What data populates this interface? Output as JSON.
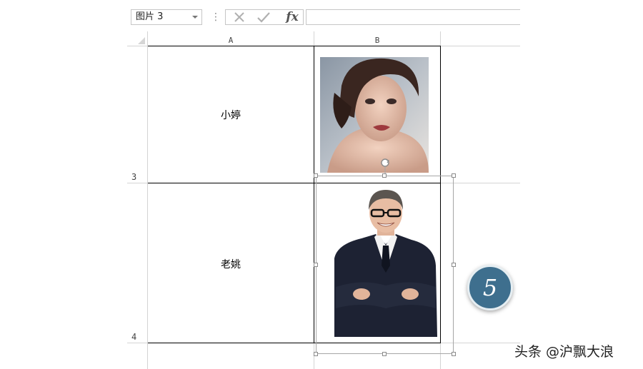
{
  "formula_bar": {
    "name_box": "图片 3",
    "cancel_icon": "x-icon",
    "enter_icon": "check-icon",
    "function_label": "fx",
    "formula": ""
  },
  "columns": [
    "A",
    "B"
  ],
  "rows": [
    {
      "number": "3",
      "name": "小婷",
      "photo": "portrait-woman"
    },
    {
      "number": "4",
      "name": "老姚",
      "photo": "portrait-man-in-suit"
    }
  ],
  "step_badge": "5",
  "watermark": "头条 @沪飘大浪",
  "colors": {
    "badge": "#3e6f8e",
    "grid": "#d4d4d4",
    "selection": "#a6a6a6"
  }
}
